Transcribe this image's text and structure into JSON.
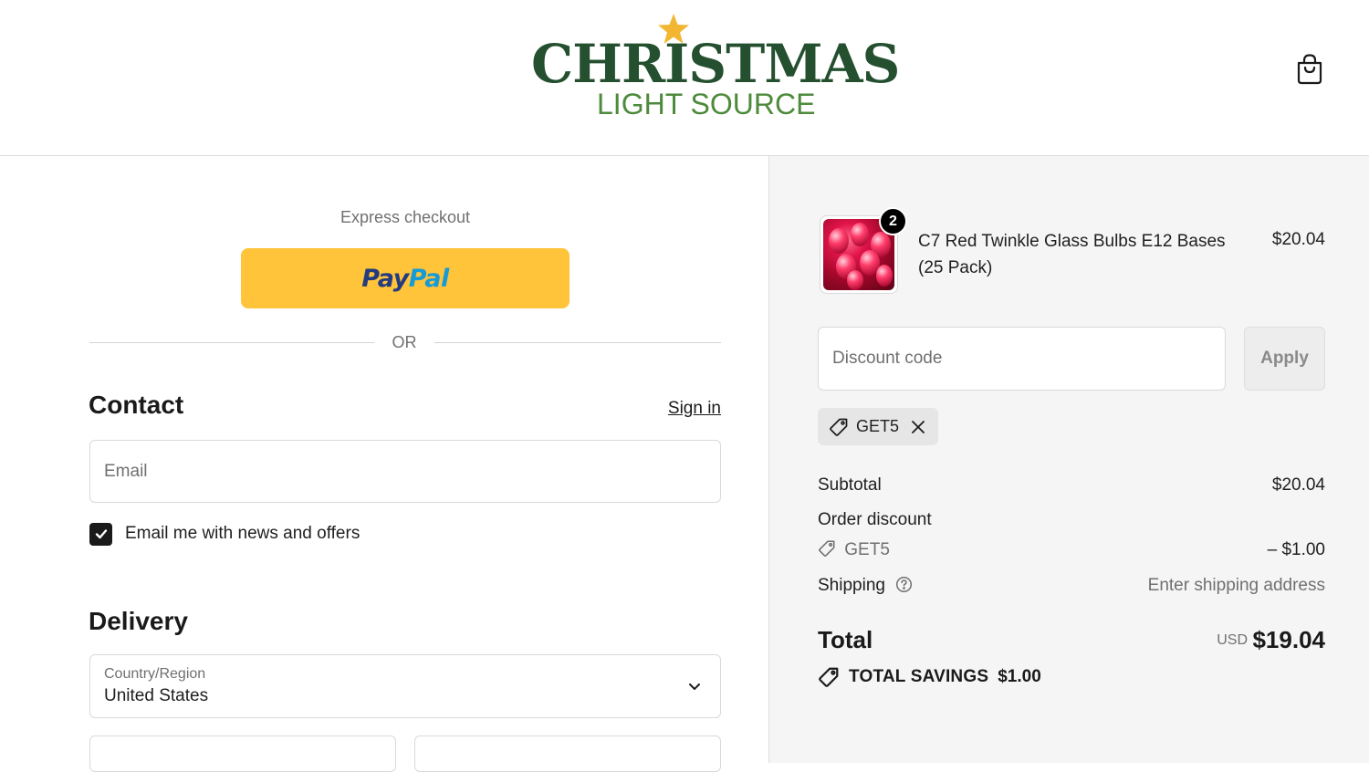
{
  "header": {
    "logo_main": "CHRISTMAS",
    "logo_sub": "LIGHT SOURCE",
    "cart_icon": "shopping-bag-icon"
  },
  "express": {
    "label": "Express checkout",
    "paypal_pay": "Pay",
    "paypal_pal": "Pal",
    "divider": "OR"
  },
  "contact": {
    "title": "Contact",
    "sign_in": "Sign in",
    "email_placeholder": "Email",
    "newsletter_label": "Email me with news and offers",
    "newsletter_checked": true
  },
  "delivery": {
    "title": "Delivery",
    "country_label": "Country/Region",
    "country_value": "United States"
  },
  "order": {
    "item": {
      "name": "C7 Red Twinkle Glass Bulbs E12 Bases (25 Pack)",
      "price": "$20.04",
      "quantity": "2"
    },
    "discount": {
      "placeholder": "Discount code",
      "apply_label": "Apply",
      "applied_code": "GET5"
    },
    "summary": {
      "subtotal_label": "Subtotal",
      "subtotal_value": "$20.04",
      "order_discount_label": "Order discount",
      "discount_code": "GET5",
      "discount_value": "– $1.00",
      "shipping_label": "Shipping",
      "shipping_value": "Enter shipping address",
      "total_label": "Total",
      "total_currency": "USD",
      "total_value": "$19.04",
      "savings_label": "TOTAL SAVINGS",
      "savings_value": "$1.00"
    }
  },
  "colors": {
    "logo_green_dark": "#24502f",
    "logo_green_light": "#4e8a3c",
    "logo_star": "#f2b632",
    "paypal_yellow": "#ffc439",
    "paypal_blue_dark": "#253b80",
    "paypal_blue_light": "#179bd7"
  }
}
